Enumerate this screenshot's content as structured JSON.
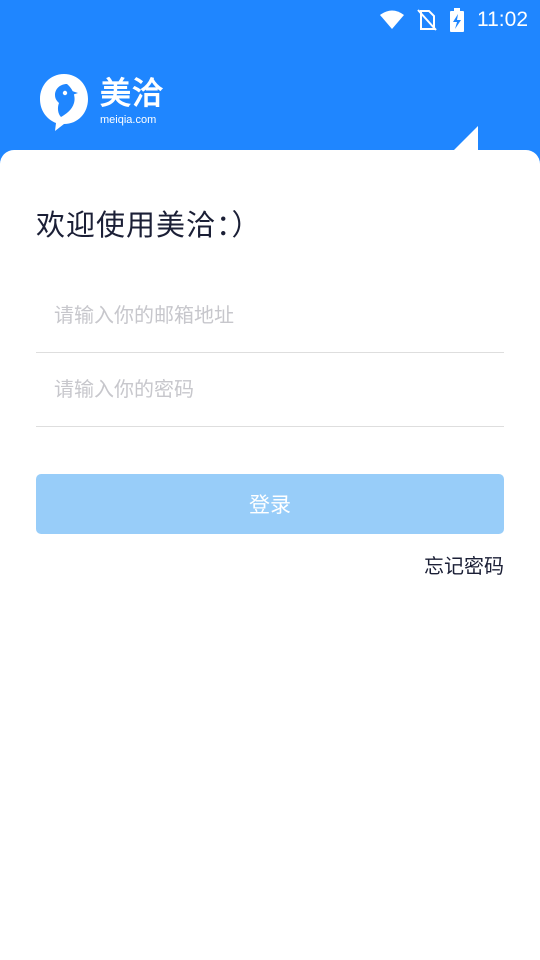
{
  "status_bar": {
    "time": "11:02",
    "icons": [
      "wifi-icon",
      "no-sim-icon",
      "battery-charging-icon"
    ]
  },
  "header": {
    "logo_icon": "meiqia-bird-bubble-icon",
    "brand_name": "美洽",
    "brand_domain": "meiqia.com"
  },
  "login": {
    "welcome_text": "欢迎使用美洽：）",
    "email": {
      "value": "",
      "placeholder": "请输入你的邮箱地址"
    },
    "password": {
      "value": "",
      "placeholder": "请输入你的密码"
    },
    "login_label": "登录",
    "forgot_password_label": "忘记密码"
  },
  "colors": {
    "brand_blue": "#1f86ff",
    "button_disabled": "#98cdf9",
    "text_dark": "#1b1f36",
    "placeholder": "#c7c7cc",
    "divider": "#dedede"
  }
}
